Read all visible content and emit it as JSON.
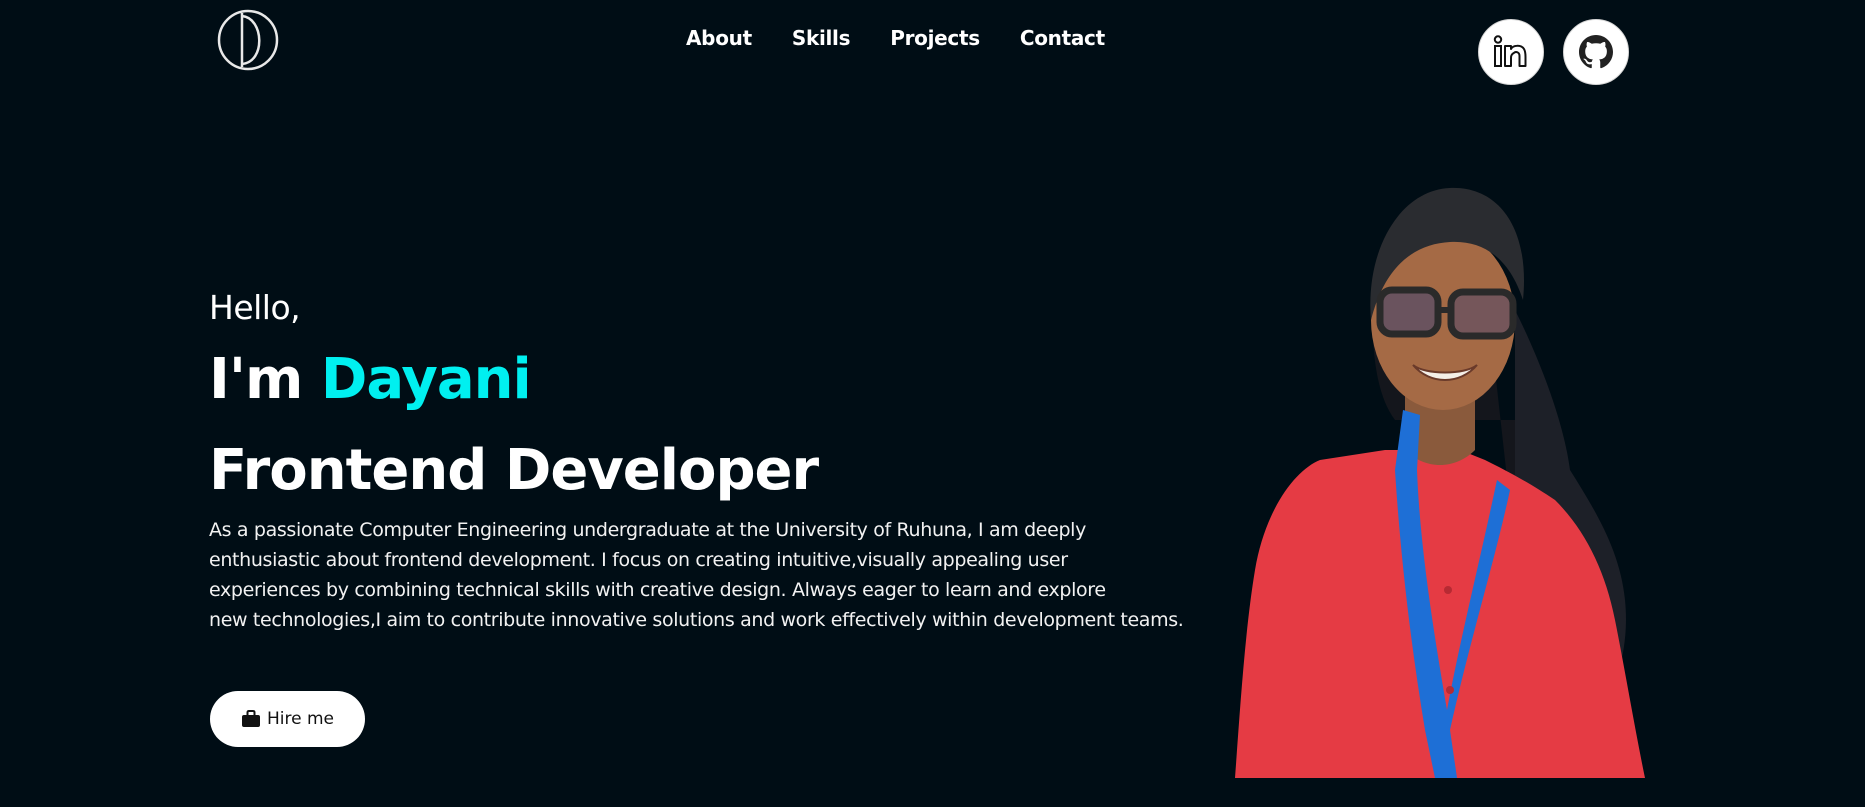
{
  "header": {
    "logo_icon": "monogram-d-logo",
    "nav": [
      {
        "label": "About"
      },
      {
        "label": "Skills"
      },
      {
        "label": "Projects"
      },
      {
        "label": "Contact"
      }
    ],
    "socials": [
      {
        "icon": "linkedin-icon"
      },
      {
        "icon": "github-icon"
      }
    ]
  },
  "hero": {
    "greeting": "Hello,",
    "intro_prefix": "I'm ",
    "name": "Dayani",
    "role": "Frontend Developer",
    "bio_lines": [
      "As a passionate Computer Engineering undergraduate at the University of Ruhuna, I am deeply",
      "enthusiastic about frontend development. I focus on creating intuitive,visually appealing user",
      "experiences by combining technical skills with creative design. Always eager to learn and explore",
      "new technologies,I aim to contribute innovative solutions and work effectively within development teams."
    ],
    "hire_button": {
      "label": "Hire me",
      "icon": "briefcase-icon"
    },
    "portrait_icon": "profile-photo"
  },
  "colors": {
    "background": "#000d15",
    "accent": "#00f0f0",
    "text": "#ffffff"
  }
}
